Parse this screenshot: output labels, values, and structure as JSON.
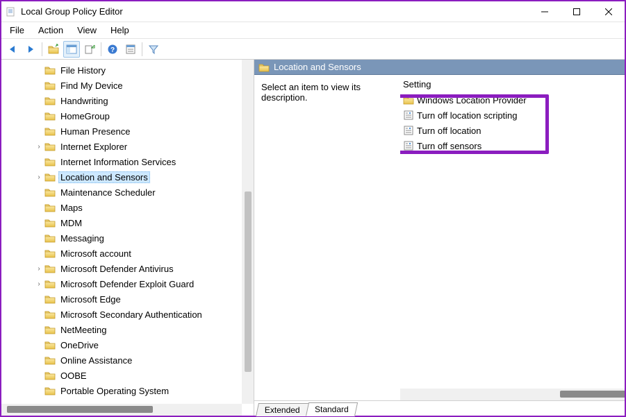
{
  "window": {
    "title": "Local Group Policy Editor"
  },
  "menubar": {
    "items": [
      "File",
      "Action",
      "View",
      "Help"
    ]
  },
  "tree": {
    "items": [
      {
        "label": "File History",
        "expander": ""
      },
      {
        "label": "Find My Device",
        "expander": ""
      },
      {
        "label": "Handwriting",
        "expander": ""
      },
      {
        "label": "HomeGroup",
        "expander": ""
      },
      {
        "label": "Human Presence",
        "expander": ""
      },
      {
        "label": "Internet Explorer",
        "expander": "›"
      },
      {
        "label": "Internet Information Services",
        "expander": ""
      },
      {
        "label": "Location and Sensors",
        "expander": "›",
        "selected": true
      },
      {
        "label": "Maintenance Scheduler",
        "expander": ""
      },
      {
        "label": "Maps",
        "expander": ""
      },
      {
        "label": "MDM",
        "expander": ""
      },
      {
        "label": "Messaging",
        "expander": ""
      },
      {
        "label": "Microsoft account",
        "expander": ""
      },
      {
        "label": "Microsoft Defender Antivirus",
        "expander": "›"
      },
      {
        "label": "Microsoft Defender Exploit Guard",
        "expander": "›"
      },
      {
        "label": "Microsoft Edge",
        "expander": ""
      },
      {
        "label": "Microsoft Secondary Authentication",
        "expander": ""
      },
      {
        "label": "NetMeeting",
        "expander": ""
      },
      {
        "label": "OneDrive",
        "expander": ""
      },
      {
        "label": "Online Assistance",
        "expander": ""
      },
      {
        "label": "OOBE",
        "expander": ""
      },
      {
        "label": "Portable Operating System",
        "expander": ""
      }
    ]
  },
  "right": {
    "header": "Location and Sensors",
    "desc": "Select an item to view its description.",
    "setting_header": "Setting",
    "items": [
      {
        "label": "Windows Location Provider",
        "type": "folder"
      },
      {
        "label": "Turn off location scripting",
        "type": "policy"
      },
      {
        "label": "Turn off location",
        "type": "policy"
      },
      {
        "label": "Turn off sensors",
        "type": "policy"
      }
    ]
  },
  "tabs": {
    "extended": "Extended",
    "standard": "Standard"
  }
}
